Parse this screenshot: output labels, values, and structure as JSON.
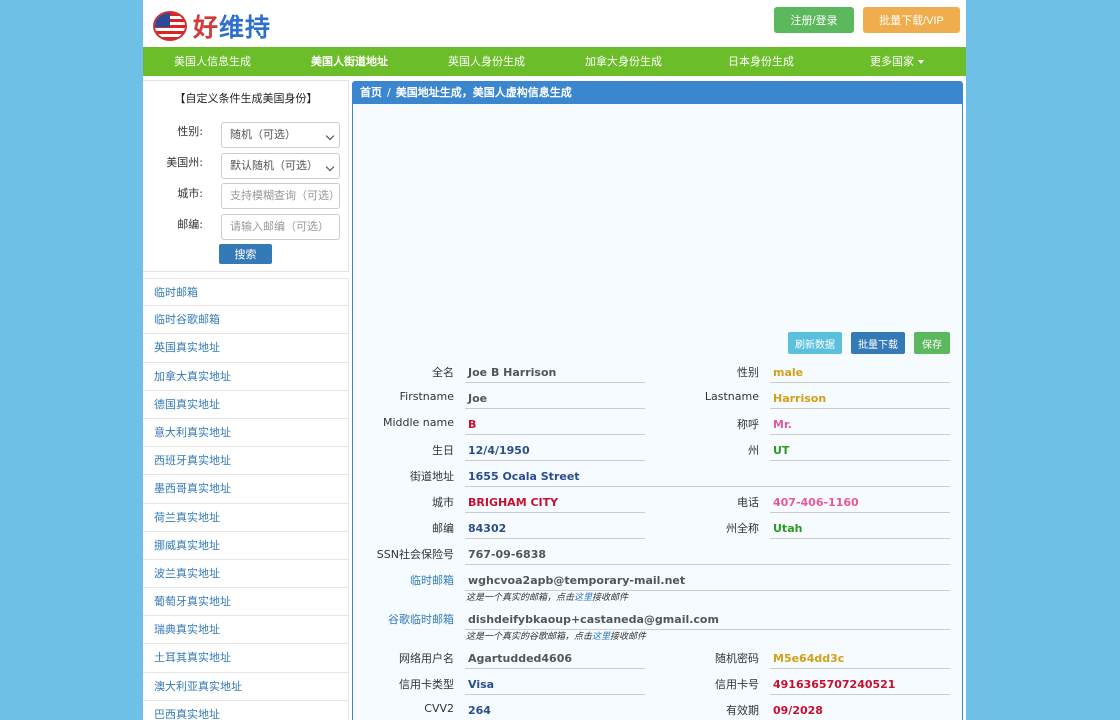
{
  "header": {
    "logo_text_part1": "好",
    "logo_text_part2": "维持",
    "login_label": "注册/登录",
    "vip_label": "批量下载/VIP"
  },
  "nav": {
    "items": [
      "美国人信息生成",
      "美国人街道地址",
      "英国人身份生成",
      "加拿大身份生成",
      "日本身份生成",
      "更多国家"
    ]
  },
  "filter": {
    "title": "【自定义条件生成美国身份】",
    "gender_label": "性别:",
    "gender_value": "随机（可选）",
    "state_label": "美国州:",
    "state_value": "默认随机（可选）",
    "city_label": "城市:",
    "city_placeholder": "支持模糊查询（可选）",
    "zip_label": "邮编:",
    "zip_placeholder": "请输入邮编（可选）",
    "search_label": "搜索"
  },
  "sidebar_links": [
    "临时邮箱",
    "临时谷歌邮箱",
    "英国真实地址",
    "加拿大真实地址",
    "德国真实地址",
    "意大利真实地址",
    "西班牙真实地址",
    "墨西哥真实地址",
    "荷兰真实地址",
    "挪威真实地址",
    "波兰真实地址",
    "葡萄牙真实地址",
    "瑞典真实地址",
    "土耳其真实地址",
    "澳大利亚真实地址",
    "巴西真实地址"
  ],
  "breadcrumb": {
    "home": "首页",
    "sep": "/",
    "current": "美国地址生成，美国人虚构信息生成"
  },
  "actions": {
    "refresh": "刷新数据",
    "batch": "批量下载",
    "save": "保存"
  },
  "info": {
    "fullname_label": "全名",
    "fullname": "Joe B Harrison",
    "gender_label": "性别",
    "gender": "male",
    "firstname_label": "Firstname",
    "firstname": "Joe",
    "lastname_label": "Lastname",
    "lastname": "Harrison",
    "middle_label": "Middle name",
    "middle": "B",
    "title_label": "称呼",
    "title": "Mr.",
    "birthday_label": "生日",
    "birthday": "12/4/1950",
    "state_label": "州",
    "state": "UT",
    "street_label": "街道地址",
    "street": "1655 Ocala Street",
    "city_label": "城市",
    "city": "BRIGHAM CITY",
    "phone_label": "电话",
    "phone": "407-406-1160",
    "zip_label": "邮编",
    "zip": "84302",
    "state_full_label": "州全称",
    "state_full": "Utah",
    "ssn_label": "SSN社会保险号",
    "ssn": "767-09-6838",
    "temp_mail_label": "临时邮箱",
    "temp_mail": "wghcvoa2apb@temporary-mail.net",
    "temp_mail_note_a": "这是一个真实的邮箱，点击",
    "temp_mail_note_link": "这里",
    "temp_mail_note_b": "接收邮件",
    "gmail_label": "谷歌临时邮箱",
    "gmail": "dishdeifybkaoup+castaneda@gmail.com",
    "gmail_note_a": "这是一个真实的谷歌邮箱，点击",
    "gmail_note_link": "这里",
    "gmail_note_b": "接收邮件",
    "username_label": "网络用户名",
    "username": "Agartudded4606",
    "password_label": "随机密码",
    "password": "M5e64dd3c",
    "cardtype_label": "信用卡类型",
    "cardtype": "Visa",
    "cardno_label": "信用卡号",
    "cardno": "4916365707240521",
    "cvv_label": "CVV2",
    "cvv": "264",
    "expiry_label": "有效期",
    "expiry": "09/2028"
  },
  "colors": {
    "nav_bg": "#6cbd2a",
    "panel_head": "#3b87cf",
    "value_blue": "#2a4d8f",
    "value_red": "#c8102e",
    "value_orange": "#d4a017",
    "value_pink": "#e8579a",
    "value_green": "#2e9a1e"
  }
}
